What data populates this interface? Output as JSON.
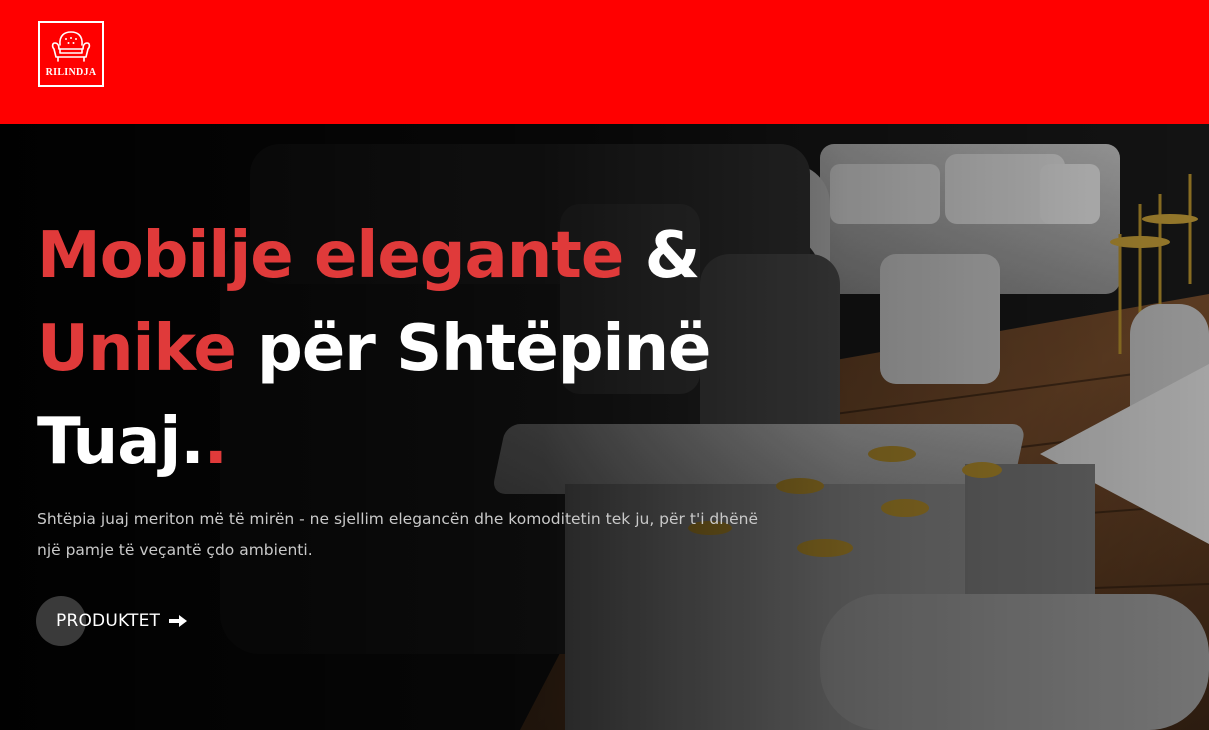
{
  "header": {
    "logo_text": "RILINDJA",
    "logo_icon": "armchair-icon",
    "background_color": "#ff0000"
  },
  "hero": {
    "headline": {
      "part1_red": "Mobilje elegante",
      "part2_white": " &",
      "part3_red": "Unike",
      "part4_white": " për Shtëpinë",
      "part5_white": "Tuaj.",
      "part6_red": "."
    },
    "subtitle_line1": "Shtëpia juaj meriton më të mirën - ne sjellim elegancën dhe komoditetin tek ju, për t'i dhënë",
    "subtitle_line2": "një pamje të veçantë çdo ambienti.",
    "cta_label": "PRODUKTET",
    "cta_icon": "arrow-right-icon",
    "accent_color": "#e03a3a"
  }
}
